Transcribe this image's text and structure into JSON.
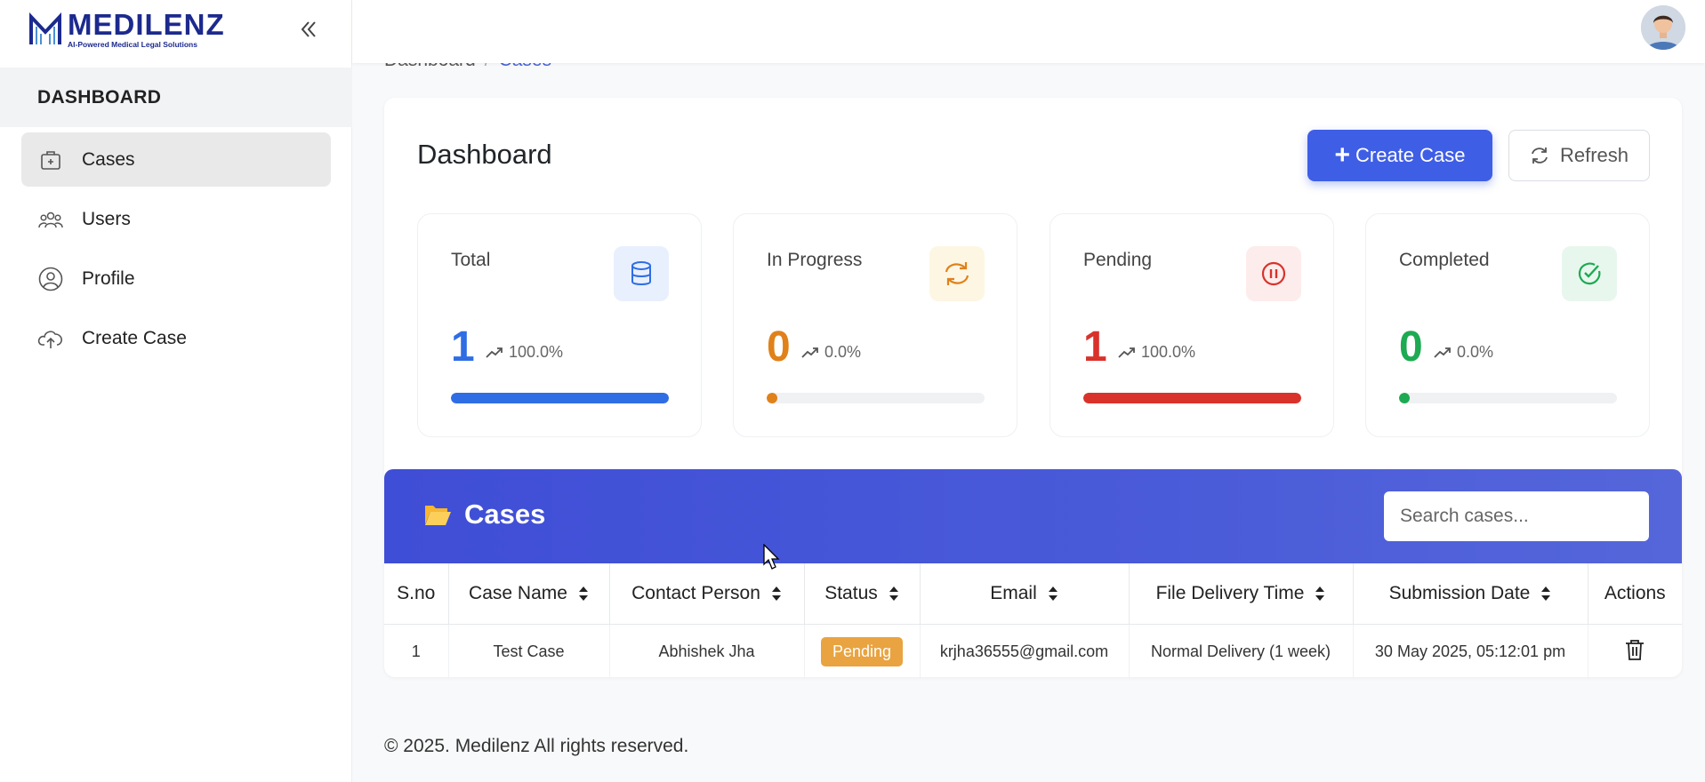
{
  "brand": {
    "name": "MEDILENZ",
    "tagline": "AI-Powered Medical Legal Solutions"
  },
  "sidebar": {
    "section": "DASHBOARD",
    "items": [
      {
        "label": "Cases",
        "icon": "briefcase-icon",
        "active": true
      },
      {
        "label": "Users",
        "icon": "users-icon"
      },
      {
        "label": "Profile",
        "icon": "user-circle-icon"
      },
      {
        "label": "Create Case",
        "icon": "cloud-upload-icon"
      }
    ]
  },
  "breadcrumb": {
    "root": "Dashboard",
    "separator": "/",
    "current": "Cases"
  },
  "main": {
    "title": "Dashboard",
    "create_label": "Create Case",
    "refresh_label": "Refresh"
  },
  "stats": [
    {
      "label": "Total",
      "value": "1",
      "percent": "100.0%",
      "progress": 1.0,
      "color": "#2f6de4",
      "icon": "database-icon"
    },
    {
      "label": "In Progress",
      "value": "0",
      "percent": "0.0%",
      "progress": 0.0,
      "color": "#e0811a",
      "icon": "refresh-icon"
    },
    {
      "label": "Pending",
      "value": "1",
      "percent": "100.0%",
      "progress": 1.0,
      "color": "#d9322b",
      "icon": "pause-circle-icon"
    },
    {
      "label": "Completed",
      "value": "0",
      "percent": "0.0%",
      "progress": 0.0,
      "color": "#1daa52",
      "icon": "check-circle-icon"
    }
  ],
  "cases": {
    "title": "Cases",
    "search_placeholder": "Search cases...",
    "columns": [
      "S.no",
      "Case Name",
      "Contact Person",
      "Status",
      "Email",
      "File Delivery Time",
      "Submission Date",
      "Actions"
    ],
    "rows": [
      {
        "sno": "1",
        "case_name": "Test Case",
        "contact": "Abhishek Jha",
        "status": "Pending",
        "email": "krjha36555@gmail.com",
        "delivery": "Normal Delivery (1 week)",
        "date": "30 May 2025, 05:12:01 pm"
      }
    ]
  },
  "footer": "© 2025. Medilenz All rights reserved."
}
